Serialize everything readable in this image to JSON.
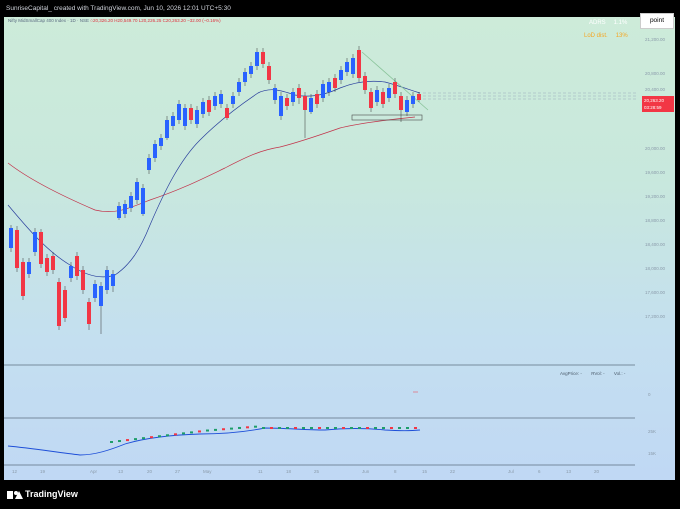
{
  "header": {
    "caption": "SunriseCapital_ created with TradingView.com, Jun 10, 2026 12:01 UTC+5:30"
  },
  "legend": {
    "symbol": "Nifty MidSmallCap 400 Index · 1D · NSE",
    "ohlc": "○20,326.20 H20,549.70 L20,226.25 C20,263.20 −32.00 (−0.16%)"
  },
  "stats": {
    "adrs_label": "ADRS",
    "adrs_value": "1.1%",
    "lod_label": "LoD dist.",
    "lod_value": "13%"
  },
  "toolbar": {
    "point_label": "point"
  },
  "price_axis": {
    "labels": [
      "21,200.00",
      "20,800.00",
      "20,400.00",
      "20,000.00",
      "19,600.00",
      "19,200.00",
      "18,800.00",
      "18,400.00",
      "18,000.00",
      "17,600.00",
      "17,200.00"
    ],
    "current_price": "20,263.20",
    "countdown": "03:28:59"
  },
  "indicator_pane": {
    "labels": [
      "AvgPrice: -",
      "RVol: -",
      "Vol.: -"
    ],
    "axis_top": "0"
  },
  "rs_pane": {
    "axis_labels": [
      "25K",
      "15K"
    ]
  },
  "time_axis": {
    "labels": [
      "12",
      "19",
      "Apr",
      "13",
      "20",
      "27",
      "May",
      "11",
      "18",
      "25",
      "Jun",
      "8",
      "15",
      "22",
      "Jul",
      "6",
      "13",
      "20"
    ]
  },
  "footer": {
    "brand": "TradingView"
  },
  "colors": {
    "up": "#2962ff",
    "down": "#f23645",
    "ma_fast": "#2a3f9d",
    "ma_slow": "#c2334a",
    "rs_line": "#1e4fd8"
  }
}
